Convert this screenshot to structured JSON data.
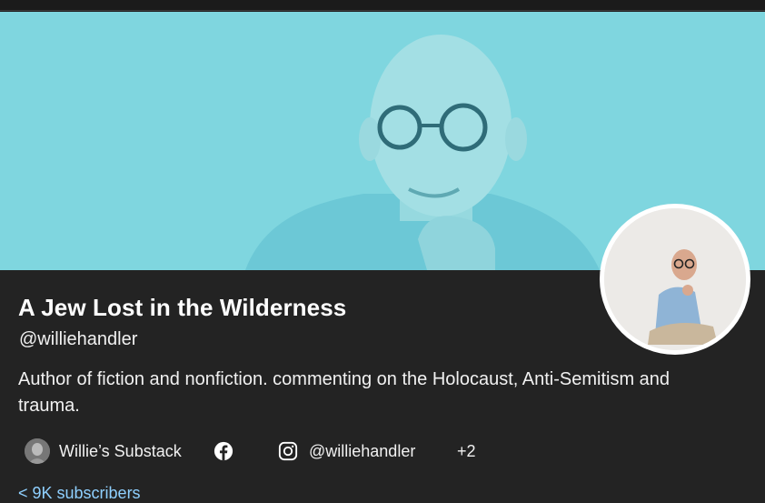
{
  "profile": {
    "name": "A Jew Lost in the Wilderness",
    "handle": "@williehandler",
    "bio": "Author of fiction and nonfiction. commenting on the Holocaust, Anti-Semitism and trauma."
  },
  "links": {
    "substack_label": "Willie’s Substack",
    "instagram_label": "@williehandler",
    "more_label": "+2"
  },
  "footer": {
    "partial_text": "< 9K subscribers"
  },
  "colors": {
    "banner": "#7fd6df",
    "background": "#232323",
    "accent": "#8fd0ff"
  },
  "icons": {
    "facebook": "facebook-icon",
    "instagram": "instagram-icon"
  }
}
